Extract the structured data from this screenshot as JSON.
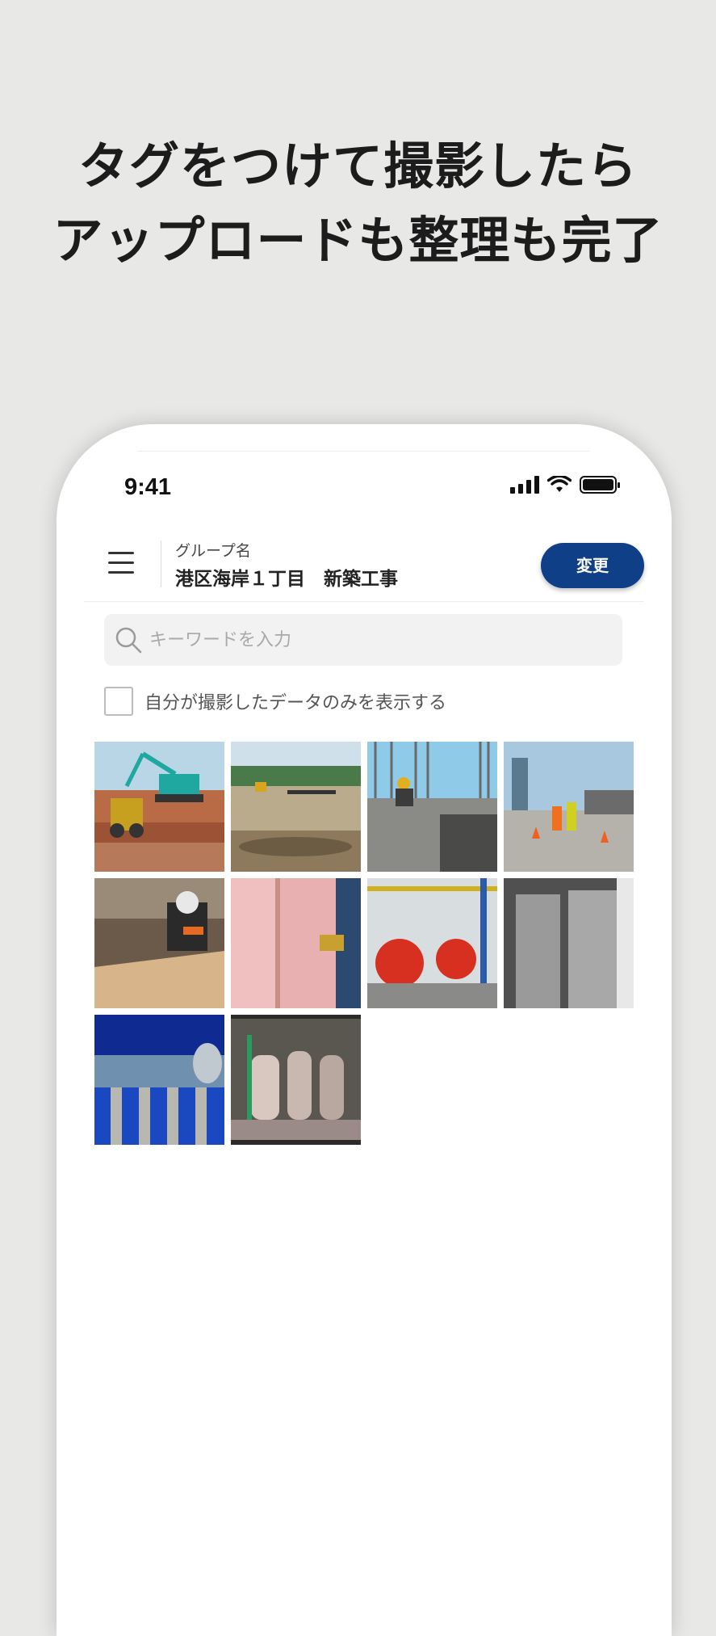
{
  "promo": {
    "line1": "タグをつけて撮影したら",
    "line2": "アップロードも整理も完了"
  },
  "status_bar": {
    "time": "9:41"
  },
  "header": {
    "group_label": "グループ名",
    "group_name": "港区海岸１丁目　新築工事",
    "change_button": "変更"
  },
  "search": {
    "placeholder": "キーワードを入力"
  },
  "filter": {
    "only_mine_label": "自分が撮影したデータのみを表示する",
    "only_mine_checked": false
  },
  "photos": [
    {
      "subject": "excavator-site"
    },
    {
      "subject": "land-clearing"
    },
    {
      "subject": "rebar-column-worker"
    },
    {
      "subject": "road-workers-cones"
    },
    {
      "subject": "carpenter-lumber"
    },
    {
      "subject": "insulation-install"
    },
    {
      "subject": "red-pumps"
    },
    {
      "subject": "water-heaters"
    },
    {
      "subject": "industrial-tanks-blue-sky"
    },
    {
      "subject": "filtration-tanks"
    }
  ],
  "colors": {
    "accent": "#0f3f86",
    "background": "#e8e8e6"
  }
}
